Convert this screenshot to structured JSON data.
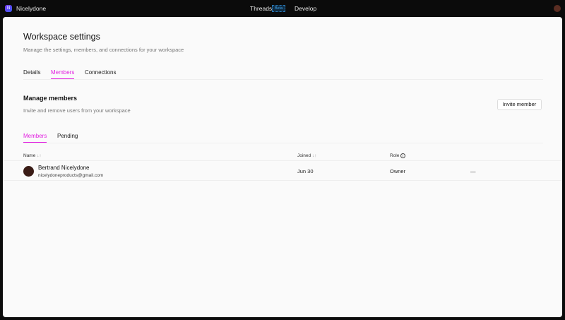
{
  "topbar": {
    "brand": "Nicelydone",
    "logo_letter": "N",
    "nav": [
      "Threads",
      "Develop"
    ],
    "beta": "Beta"
  },
  "page": {
    "title": "Workspace settings",
    "subtitle": "Manage the settings, members, and connections for your workspace",
    "tabs": [
      "Details",
      "Members",
      "Connections"
    ],
    "active_tab": "Members"
  },
  "members": {
    "title": "Manage members",
    "subtitle": "Invite and remove users from your workspace",
    "invite_label": "Invite member",
    "subtabs": [
      "Members",
      "Pending"
    ],
    "active_subtab": "Members",
    "columns": [
      "Name",
      "Joined",
      "Role"
    ],
    "rows": [
      {
        "name": "Bertrand Nicelydone",
        "email": "nicelydoneproducts@gmail.com",
        "joined": "Jun 30",
        "role": "Owner",
        "action": "—"
      }
    ]
  },
  "colors": {
    "accent": "#e21fe0"
  }
}
